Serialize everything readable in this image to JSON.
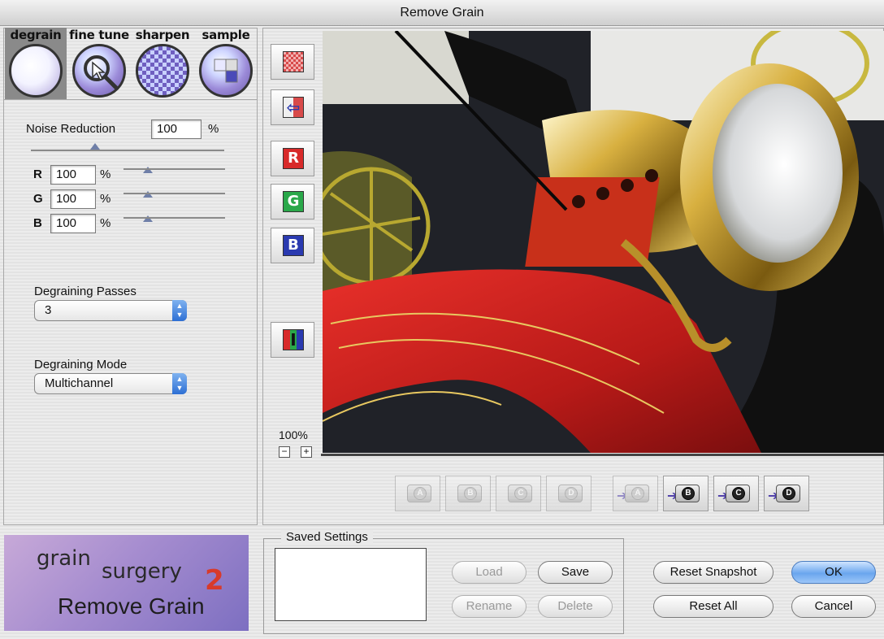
{
  "window": {
    "title": "Remove Grain"
  },
  "tabs": [
    {
      "label": "degrain",
      "active": true
    },
    {
      "label": "fine tune",
      "active": false
    },
    {
      "label": "sharpen",
      "active": false
    },
    {
      "label": "sample",
      "active": false
    }
  ],
  "noise_reduction": {
    "label": "Noise Reduction",
    "value": "100",
    "unit": "%",
    "channels": [
      {
        "label": "R",
        "value": "100",
        "unit": "%"
      },
      {
        "label": "G",
        "value": "100",
        "unit": "%"
      },
      {
        "label": "B",
        "value": "100",
        "unit": "%"
      }
    ]
  },
  "passes": {
    "label": "Degraining Passes",
    "value": "3"
  },
  "mode": {
    "label": "Degraining Mode",
    "value": "Multichannel"
  },
  "tools": {
    "red": "R",
    "green": "G",
    "blue": "B"
  },
  "zoom": {
    "level": "100%",
    "minus": "−",
    "plus": "+"
  },
  "snapshots": {
    "recall": [
      "A",
      "B",
      "C",
      "D"
    ],
    "store": [
      "A",
      "B",
      "C",
      "D"
    ]
  },
  "saved_settings": {
    "legend": "Saved Settings",
    "load": "Load",
    "save": "Save",
    "rename": "Rename",
    "delete": "Delete"
  },
  "actions": {
    "reset_snapshot": "Reset Snapshot",
    "reset_all": "Reset All",
    "ok": "OK",
    "cancel": "Cancel"
  },
  "logo": {
    "line1": "grain",
    "line2": "surgery",
    "version": "2",
    "subtitle": "Remove Grain"
  },
  "colors": {
    "accent": "#6aa6ee",
    "red_tool": "#d82a2a",
    "green_tool": "#2aa84a",
    "blue_tool": "#2a3ab0"
  }
}
